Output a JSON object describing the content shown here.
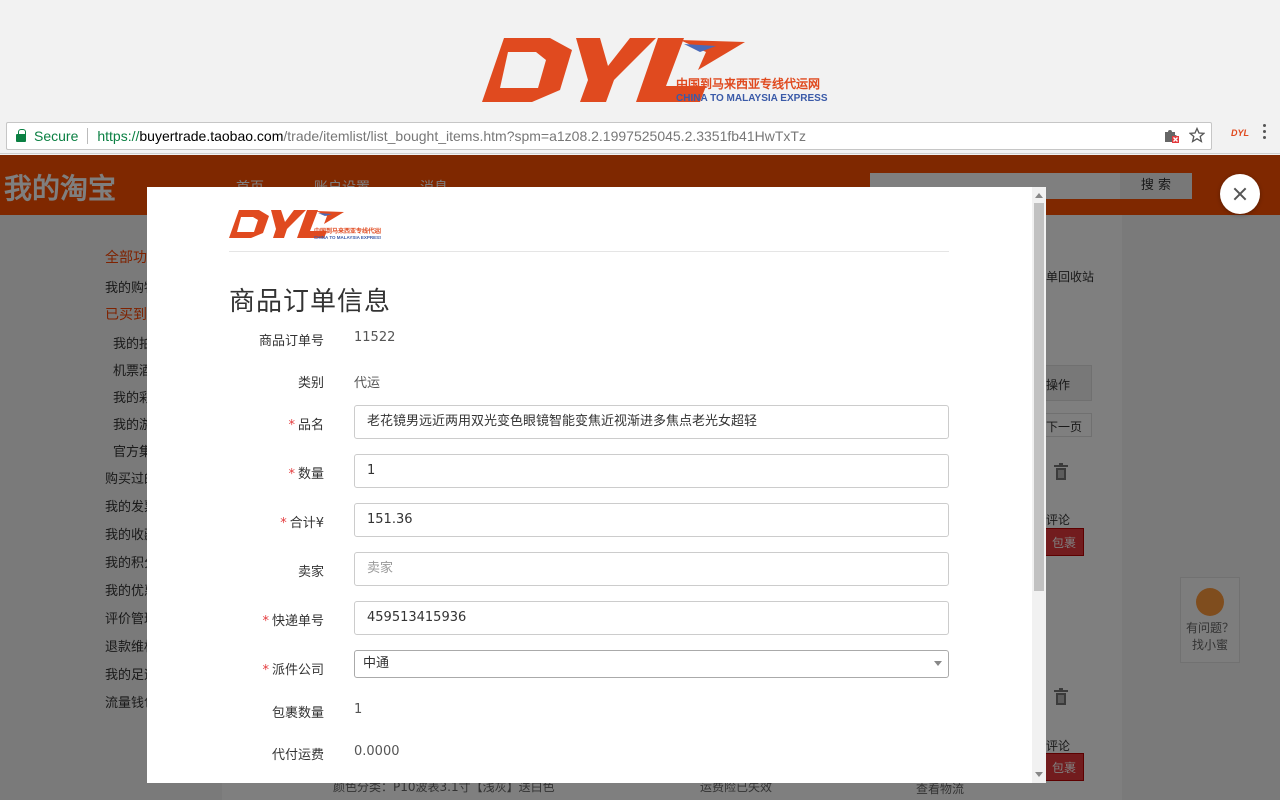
{
  "browser": {
    "secure_label": "Secure",
    "url_scheme": "https://",
    "url_host": "buyertrade.taobao.com",
    "url_path": "/trade/itemlist/list_bought_items.htm?spm=a1z08.2.1997525045.2.3351fb41HwTxTz"
  },
  "banner": {
    "logo_text": "DYL",
    "tagline_cn": "中国到马来西亚专线代运网",
    "tagline_en": "CHINA TO MALAYSIA EXPRESS"
  },
  "background_page": {
    "site_title": "我的淘宝",
    "nav": [
      "首页",
      "账户设置",
      "消息"
    ],
    "search_button": "搜 索",
    "sidebar_items": [
      {
        "label": "全部功",
        "style": "red"
      },
      {
        "label": "我的购物",
        "style": "normal"
      },
      {
        "label": "已买到的",
        "style": "red"
      },
      {
        "label": "我的拍",
        "style": "sub"
      },
      {
        "label": "机票酒",
        "style": "sub"
      },
      {
        "label": "我的彩",
        "style": "sub"
      },
      {
        "label": "我的游",
        "style": "sub"
      },
      {
        "label": "官方集",
        "style": "sub"
      },
      {
        "label": "购买过的",
        "style": "normal"
      },
      {
        "label": "我的发票",
        "style": "normal"
      },
      {
        "label": "我的收藏",
        "style": "normal"
      },
      {
        "label": "我的积分",
        "style": "normal"
      },
      {
        "label": "我的优惠",
        "style": "normal"
      },
      {
        "label": "评价管理",
        "style": "normal"
      },
      {
        "label": "退款维权",
        "style": "normal"
      },
      {
        "label": "我的足迹",
        "style": "normal"
      },
      {
        "label": "流量钱包",
        "style": "normal"
      }
    ],
    "right_texts": [
      "单回收站",
      "操作",
      "下一页",
      "评论",
      "包裹",
      "评论",
      "包裹"
    ],
    "helper_text_1": "有问题？",
    "helper_text_2": "找小蜜",
    "bottom_text_1": "颜色分类：P10波表3.1寸【浅灰】送白色",
    "bottom_text_2": "运费险已失效",
    "bottom_text_3": "查看物流"
  },
  "modal": {
    "title": "商品订单信息",
    "fields": {
      "order_no": {
        "label": "商品订单号",
        "value": "11522"
      },
      "category": {
        "label": "类别",
        "value": "代运"
      },
      "product_name": {
        "label": "品名",
        "value": "老花镜男远近两用双光变色眼镜智能变焦近视渐进多焦点老光女超轻"
      },
      "quantity": {
        "label": "数量",
        "value": "1"
      },
      "total": {
        "label": "合计¥",
        "value": "151.36"
      },
      "seller": {
        "label": "卖家",
        "placeholder": "卖家"
      },
      "tracking_no": {
        "label": "快递单号",
        "value": "459513415936"
      },
      "courier": {
        "label": "派件公司",
        "selected": "中通"
      },
      "package_count": {
        "label": "包裹数量",
        "value": "1"
      },
      "shipping_fee": {
        "label": "代付运费",
        "value": "0.0000"
      }
    },
    "required_mark": "*"
  },
  "colors": {
    "brand_orange": "#ff5000",
    "logo_red": "#e04a1f",
    "required_red": "#e4393c",
    "secure_green": "#0b8043"
  }
}
